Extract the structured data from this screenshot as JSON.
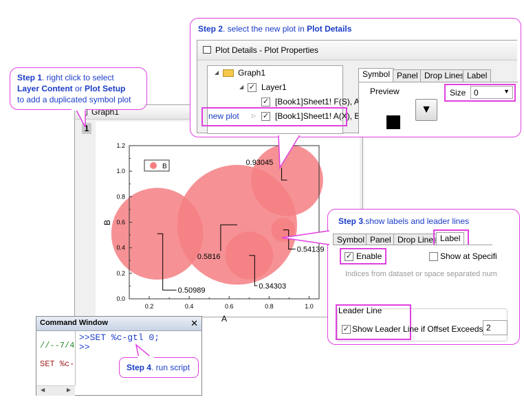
{
  "step1": {
    "prefix": "Step 1",
    "text1": ". right click to select",
    "bold1": "Layer Content",
    "mid": " or ",
    "bold2": "Plot Setup",
    "text2": "to add a duplicated symbol plot"
  },
  "step2": {
    "prefix": "Step 2",
    "text1": ". select the new plot in ",
    "bold1": "Plot Details"
  },
  "step3": {
    "prefix": "Step 3",
    "text1": ".show labels and leader lines"
  },
  "step4": {
    "prefix": "Step 4",
    "text1": ". run script"
  },
  "graph_window": {
    "title": "Graph1",
    "layer_index": "1"
  },
  "plot_details": {
    "title": "Plot Details - Plot Properties",
    "tree": {
      "graph": "Graph1",
      "layer": "Layer1",
      "plot1": "[Book1]Sheet1! F(S), A",
      "plot2": "[Book1]Sheet1! A(X), B",
      "new_plot_label": "new plot"
    },
    "tabs": [
      "Symbol",
      "Panel",
      "Drop Lines",
      "Label"
    ],
    "preview_label": "Preview",
    "size_label": "Size",
    "size_value": "0"
  },
  "label_tab": {
    "tabs": [
      "Symbol",
      "Panel",
      "Drop Lines",
      "Label"
    ],
    "enable_label": "Enable",
    "show_at_label": "Show at Specifi",
    "indices_label": "Indices from dataset or space separated num",
    "leader_group": "Leader Line",
    "show_leader_label": "Show Leader Line if Offset Exceeds (%)",
    "offset_value": "2"
  },
  "command_window": {
    "title": "Command Window",
    "history": [
      "//--7/4",
      "SET %c-"
    ],
    "lines": [
      ">>SET %c-gtl 0;",
      ">>"
    ]
  },
  "chart_data": {
    "type": "scatter",
    "xlabel": "A",
    "ylabel": "B",
    "xlim": [
      0.1,
      1.05
    ],
    "ylim": [
      0,
      1.2
    ],
    "xticks": [
      "0.2",
      "0.4",
      "0.6",
      "0.8",
      "1.0"
    ],
    "yticks": [
      "0.0",
      "0.2",
      "0.4",
      "0.6",
      "0.8",
      "1.0",
      "1.2"
    ],
    "legend": "B",
    "bubble_color": "#f47f82",
    "points": [
      {
        "x": 0.24,
        "y": 0.51,
        "r": 0.23,
        "label": "0.50989"
      },
      {
        "x": 0.64,
        "y": 0.58,
        "r": 0.3,
        "label": "0.5816"
      },
      {
        "x": 0.89,
        "y": 0.93,
        "r": 0.18,
        "label": "0.93045"
      },
      {
        "x": 0.7,
        "y": 0.34,
        "r": 0.12,
        "label": "0.34303"
      },
      {
        "x": 0.87,
        "y": 0.54,
        "r": 0.06,
        "label": "0.54139"
      }
    ]
  }
}
